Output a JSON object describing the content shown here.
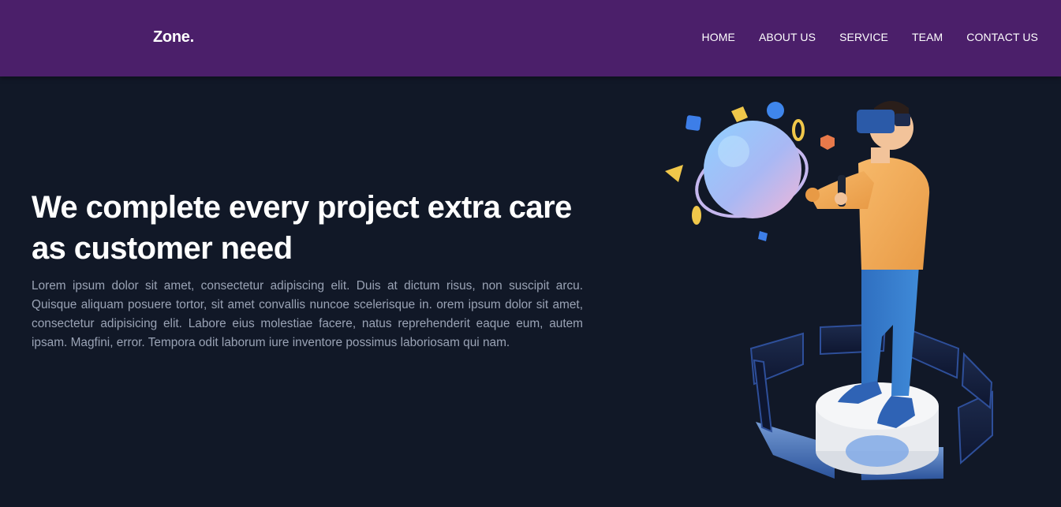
{
  "nav": {
    "logo": "Zone.",
    "links": [
      {
        "label": "HOME"
      },
      {
        "label": "ABOUT US"
      },
      {
        "label": "SERVICE"
      },
      {
        "label": "TEAM"
      },
      {
        "label": "CONTACT US"
      }
    ]
  },
  "hero": {
    "title": "We complete every project extra care as customer need",
    "text": "Lorem ipsum dolor sit amet, consectetur adipiscing elit. Duis at dictum risus, non suscipit arcu. Quisque aliquam posuere tortor, sit amet convallis nuncoe scelerisque in. orem ipsum dolor sit amet, consectetur adipisicing elit. Labore eius molestiae facere, natus reprehenderit eaque eum, autem ipsam. Magfini, error. Tempora odit laborum iure inventore possimus laboriosam qui nam."
  },
  "colors": {
    "navbar": "#4b1f6a",
    "background": "#111827",
    "heading": "#ffffff",
    "body_text": "#9aa3b5"
  }
}
